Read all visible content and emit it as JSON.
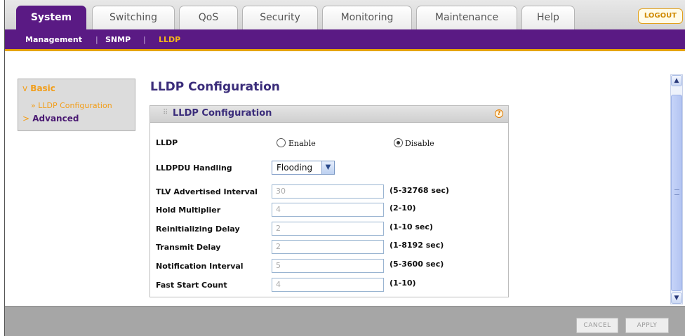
{
  "tabs": [
    {
      "label": "System",
      "active": true
    },
    {
      "label": "Switching",
      "active": false
    },
    {
      "label": "QoS",
      "active": false
    },
    {
      "label": "Security",
      "active": false
    },
    {
      "label": "Monitoring",
      "active": false
    },
    {
      "label": "Maintenance",
      "active": false
    },
    {
      "label": "Help",
      "active": false
    }
  ],
  "logout_label": "LOGOUT",
  "subnav": {
    "items": [
      "Management",
      "SNMP",
      "LLDP"
    ],
    "separator": "|",
    "current": "LLDP"
  },
  "leftmenu": {
    "basic_arrow": "v",
    "basic": "Basic",
    "sub_arrow": "»",
    "sub_item": "LLDP Configuration",
    "advanced_arrow": ">",
    "advanced": "Advanced"
  },
  "page_title": "LLDP Configuration",
  "box": {
    "title": "LLDP Configuration",
    "help_icon": "?",
    "lldp": {
      "label": "LLDP",
      "enable_label": "Enable",
      "disable_label": "Disable",
      "selected": "Disable"
    },
    "lldpdu": {
      "label": "LLDPDU Handling",
      "value": "Flooding"
    },
    "fields": [
      {
        "label": "TLV Advertised Interval",
        "value": "30",
        "range": "(5-32768 sec)"
      },
      {
        "label": "Hold Multiplier",
        "value": "4",
        "range": "(2-10)"
      },
      {
        "label": "Reinitializing Delay",
        "value": "2",
        "range": "(1-10 sec)"
      },
      {
        "label": "Transmit Delay",
        "value": "2",
        "range": "(1-8192 sec)"
      },
      {
        "label": "Notification Interval",
        "value": "5",
        "range": "(5-3600 sec)"
      },
      {
        "label": "Fast Start Count",
        "value": "4",
        "range": "(1-10)"
      }
    ]
  },
  "footer": {
    "cancel_label": "CANCEL",
    "apply_label": "APPLY"
  },
  "colors": {
    "brand_purple": "#5a1a84",
    "accent_orange": "#f29e1a"
  },
  "icons": {
    "scroll_up": "up-arrow-icon",
    "scroll_down": "down-arrow-icon",
    "help": "help-icon",
    "dropdown": "chevron-down-icon"
  }
}
